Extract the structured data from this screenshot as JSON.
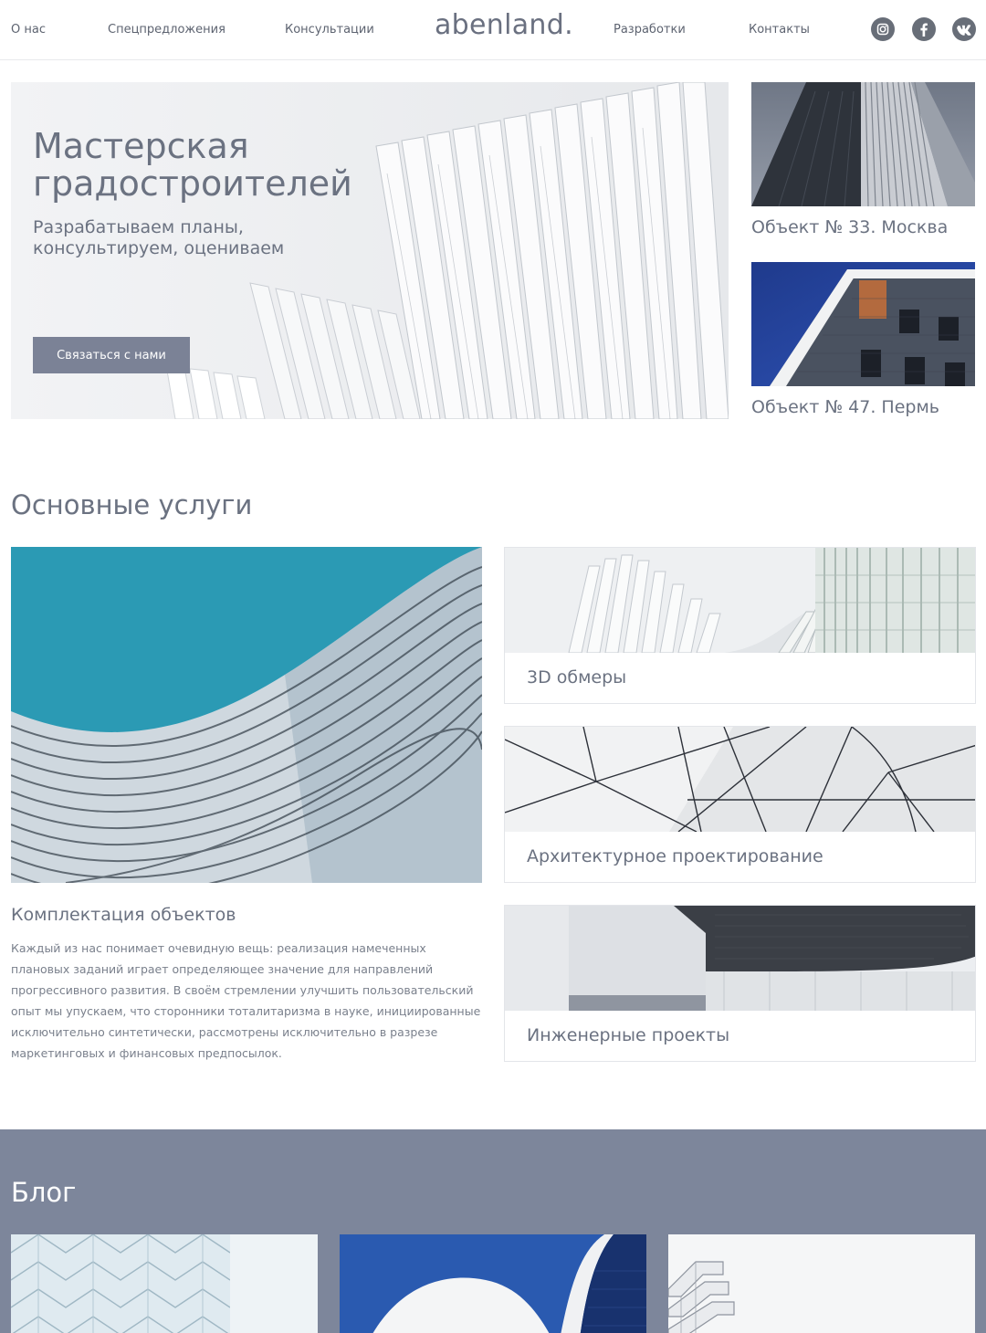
{
  "header": {
    "nav_left": [
      "О нас",
      "Спецпредложения",
      "Консультации"
    ],
    "logo": "abenland.",
    "nav_right": [
      "Разработки",
      "Контакты"
    ],
    "social": [
      "instagram-icon",
      "facebook-icon",
      "vk-icon"
    ]
  },
  "hero": {
    "title": "Мастерская\nградостроителей",
    "subtitle": "Разрабатываем планы,\nконсультируем, оцениваем",
    "button": "Связаться с нами"
  },
  "projects": [
    {
      "caption": "Объект № 33. Москва"
    },
    {
      "caption": "Объект № 47. Пермь"
    }
  ],
  "services": {
    "title": "Основные услуги",
    "main": {
      "title": "Комплектация объектов",
      "text": "Каждый из нас понимает очевидную вещь: реализация намеченных плановых заданий играет определяющее значение для направлений прогрессивного развития. В своём стремлении улучшить пользовательский опыт мы упускаем, что сторонники тоталитаризма в науке, инициированные исключительно синтетически, рассмотрены исключительно в разрезе маркетинговых и финансовых предпосылок."
    },
    "cards": [
      {
        "label": "3D обмеры"
      },
      {
        "label": "Архитектурное проектирование"
      },
      {
        "label": "Инженерные проекты"
      }
    ]
  },
  "blog": {
    "title": "Блог"
  },
  "colors": {
    "accent": "#7b8296",
    "blog_bg": "#7d869b",
    "text": "#6b7281"
  }
}
